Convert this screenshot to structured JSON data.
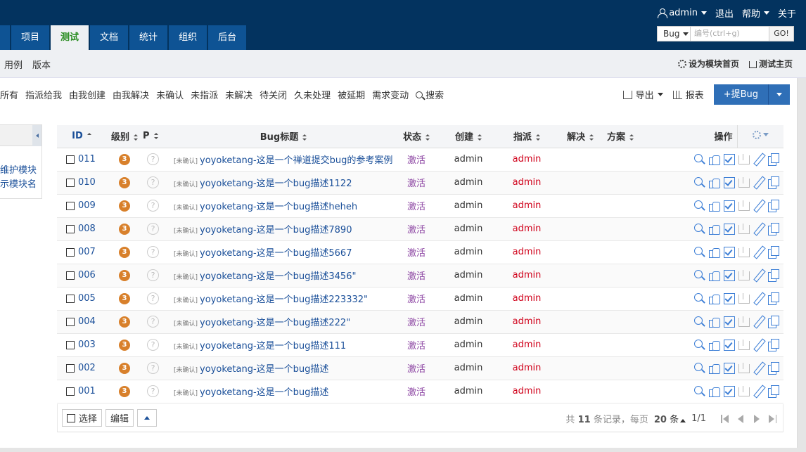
{
  "header": {
    "user": "admin",
    "logout": "退出",
    "help": "帮助",
    "about": "关于"
  },
  "main_nav": {
    "tabs": [
      {
        "label": "项目",
        "active": false
      },
      {
        "label": "测试",
        "active": true
      },
      {
        "label": "文档",
        "active": false
      },
      {
        "label": "统计",
        "active": false
      },
      {
        "label": "组织",
        "active": false
      },
      {
        "label": "后台",
        "active": false
      }
    ]
  },
  "search": {
    "type": "Bug",
    "placeholder": "编号(ctrl+g)",
    "go": "GO!"
  },
  "sub_nav": {
    "items": [
      "用例",
      "版本"
    ],
    "set_home": "设为模块首页",
    "test_home": "测试主页"
  },
  "features": {
    "items": [
      "所有",
      "指派给我",
      "由我创建",
      "由我解决",
      "未确认",
      "未指派",
      "未解决",
      "待关闭",
      "久未处理",
      "被延期",
      "需求变动"
    ],
    "search": "搜索"
  },
  "actions": {
    "export": "导出",
    "report": "报表",
    "new_bug": "+提Bug"
  },
  "tree": {
    "links": [
      "维护模块",
      "示模块名"
    ]
  },
  "table": {
    "columns": {
      "id": "ID",
      "severity": "级别",
      "pri": "P",
      "title": "Bug标题",
      "status": "状态",
      "creator": "创建",
      "assigned": "指派",
      "resolved": "解决",
      "solution": "方案",
      "actions": "操作"
    },
    "rows": [
      {
        "id": "011",
        "severity": "3",
        "pri": "?",
        "tag": "[未确认]",
        "title": "yoyoketang-这是一个禅道提交bug的参考案例",
        "status": "激活",
        "creator": "admin",
        "assigned": "admin"
      },
      {
        "id": "010",
        "severity": "3",
        "pri": "?",
        "tag": "[未确认]",
        "title": "yoyoketang-这是一个bug描述1122",
        "status": "激活",
        "creator": "admin",
        "assigned": "admin"
      },
      {
        "id": "009",
        "severity": "3",
        "pri": "?",
        "tag": "[未确认]",
        "title": "yoyoketang-这是一个bug描述heheh",
        "status": "激活",
        "creator": "admin",
        "assigned": "admin"
      },
      {
        "id": "008",
        "severity": "3",
        "pri": "?",
        "tag": "[未确认]",
        "title": "yoyoketang-这是一个bug描述7890",
        "status": "激活",
        "creator": "admin",
        "assigned": "admin"
      },
      {
        "id": "007",
        "severity": "3",
        "pri": "?",
        "tag": "[未确认]",
        "title": "yoyoketang-这是一个bug描述5667",
        "status": "激活",
        "creator": "admin",
        "assigned": "admin"
      },
      {
        "id": "006",
        "severity": "3",
        "pri": "?",
        "tag": "[未确认]",
        "title": "yoyoketang-这是一个bug描述3456\"",
        "status": "激活",
        "creator": "admin",
        "assigned": "admin"
      },
      {
        "id": "005",
        "severity": "3",
        "pri": "?",
        "tag": "[未确认]",
        "title": "yoyoketang-这是一个bug描述223332\"",
        "status": "激活",
        "creator": "admin",
        "assigned": "admin"
      },
      {
        "id": "004",
        "severity": "3",
        "pri": "?",
        "tag": "[未确认]",
        "title": "yoyoketang-这是一个bug描述222\"",
        "status": "激活",
        "creator": "admin",
        "assigned": "admin"
      },
      {
        "id": "003",
        "severity": "3",
        "pri": "?",
        "tag": "[未确认]",
        "title": "yoyoketang-这是一个bug描述111",
        "status": "激活",
        "creator": "admin",
        "assigned": "admin"
      },
      {
        "id": "002",
        "severity": "3",
        "pri": "?",
        "tag": "[未确认]",
        "title": "yoyoketang-这是一个bug描述",
        "status": "激活",
        "creator": "admin",
        "assigned": "admin"
      },
      {
        "id": "001",
        "severity": "3",
        "pri": "?",
        "tag": "[未确认]",
        "title": "yoyoketang-这是一个bug描述",
        "status": "激活",
        "creator": "admin",
        "assigned": "admin"
      }
    ]
  },
  "footer": {
    "select": "选择",
    "edit": "编辑",
    "total_prefix": "共",
    "total": "11",
    "total_suffix": "条记录，每页",
    "per_page": "20",
    "per_page_suffix": "条",
    "page": "1/1"
  },
  "colors": {
    "header_bg": "#03335f",
    "tab_bg": "#0e5394",
    "active_tab_text": "#2a8d22",
    "link": "#1a4f99",
    "status": "#8d46a3",
    "assigned": "#d0021b",
    "severity": "#d8802b",
    "primary_button": "#2f6fb7"
  }
}
